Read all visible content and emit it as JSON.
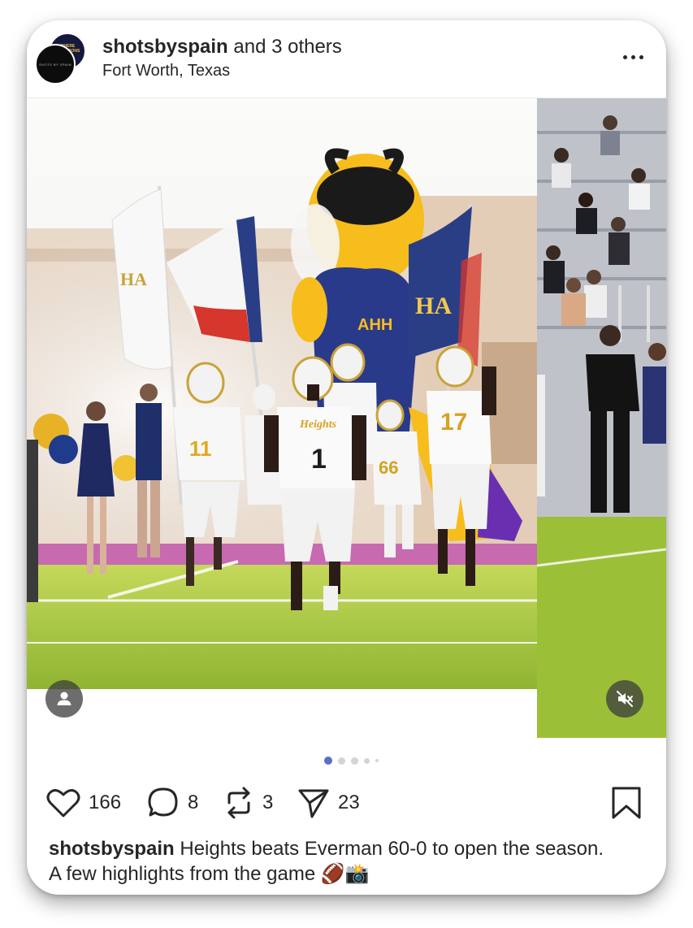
{
  "post": {
    "avatar_back_text": "WHERE CHAMPIONS MADE",
    "avatar_front_text": "SHOTS BY SPAIN",
    "username": "shotsbyspain",
    "coauthors": " and 3 others",
    "location": "Fort Worth, Texas"
  },
  "photo": {
    "jersey_center": "1",
    "jersey_right": "17",
    "jersey_back": "66",
    "jersey_left": "11",
    "team_script": "Heights",
    "mascot_text": "AHH",
    "flag_text": "HA"
  },
  "carousel": {
    "total_dots": 5,
    "active_index": 0
  },
  "actions": {
    "likes": "166",
    "comments": "8",
    "reposts": "3",
    "shares": "23"
  },
  "caption": {
    "username": "shotsbyspain",
    "text": " Heights beats Everman 60-0 to open the season.  A few highlights from the game 🏈📸"
  },
  "colors": {
    "accent_dot": "#5b6fc6",
    "text": "#262626",
    "field_green": "#a8c93c",
    "jersey_gold": "#f2b824",
    "navy": "#2b3b73"
  },
  "icons": {
    "like": "heart-icon",
    "comment": "comment-bubble-icon",
    "repost": "repost-icon",
    "share": "paper-plane-icon",
    "save": "bookmark-icon",
    "tag": "person-icon",
    "mute": "speaker-muted-icon",
    "more": "more-options-icon"
  }
}
